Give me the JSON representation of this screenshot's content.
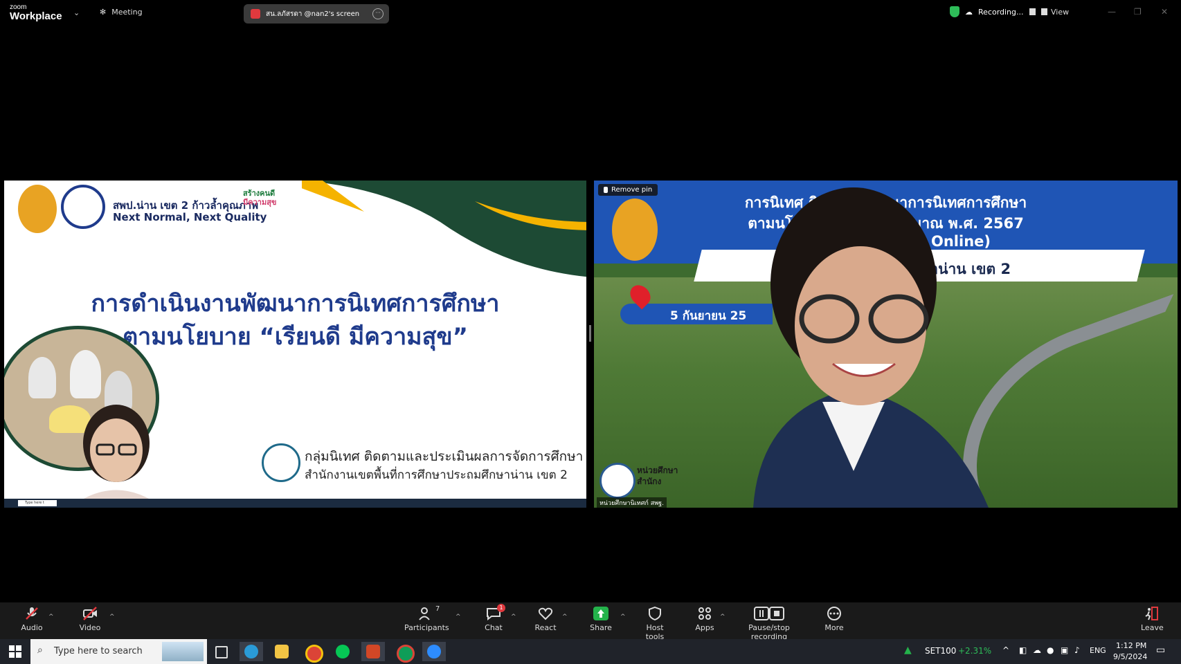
{
  "titlebar": {
    "logo_small": "zoom",
    "logo_big": "Workplace",
    "meeting_label": "Meeting",
    "share_label": "สน.ลภัสรดา @nan2's screen",
    "recording_label": "Recording...",
    "view_label": "View"
  },
  "left_tile": {
    "org_line1": "สพป.น่าน เขต 2 ก้าวล้ำคุณภาพ",
    "org_line2": "Next Normal, Next Quality",
    "badge_line1": "สร้างคนดี",
    "badge_line2": "มีความสุข",
    "title_line1": "การดำเนินงานพัฒนาการนิเทศการศึกษา",
    "title_line2": "ตามนโยบาย “เรียนดี มีความสุข”",
    "dept_line1": "กลุ่มนิเทศ ติดตามและประเมินผลการจัดการศึกษา",
    "dept_line2": "สำนักงานเขตพื้นที่การศึกษาประถมศึกษาน่าน เขต 2",
    "mini_search": "Type here t"
  },
  "right_tile": {
    "remove_pin": "Remove pin",
    "banner_line1": "การนิเทศ ติดต          งานพัฒนาการนิเทศการศึกษา",
    "banner_line2": "ตามนโยบายเ            ะจำปีงบประมาณ พ.ศ. 2567",
    "banner_line3": "Online)",
    "banner_office": "สำนักงา                        ถมศึกษาน่าน เขต 2",
    "date_text": "5 กันยายน 25",
    "logo_text1": "หน่วยศึกษา",
    "logo_text2": "สำนักง",
    "name_tag": "หน่วยศึกษานิเทศก์ สพฐ."
  },
  "toolbar": {
    "audio": "Audio",
    "video": "Video",
    "participants": "Participants",
    "participants_count": "7",
    "chat": "Chat",
    "chat_badge": "1",
    "react": "React",
    "share": "Share",
    "host_tools": "Host tools",
    "apps": "Apps",
    "pause_stop": "Pause/stop recording",
    "more": "More",
    "leave": "Leave"
  },
  "taskbar": {
    "search_placeholder": "Type here to search",
    "stock_name": "SET100",
    "stock_change": "+2.31%",
    "lang": "ENG",
    "time": "1:12 PM",
    "date": "9/5/2024"
  },
  "colors": {
    "accent_green": "#24b24b",
    "danger_red": "#e0393e",
    "slide_blue": "#1f3b8c",
    "banner_blue": "#1f55b5"
  }
}
